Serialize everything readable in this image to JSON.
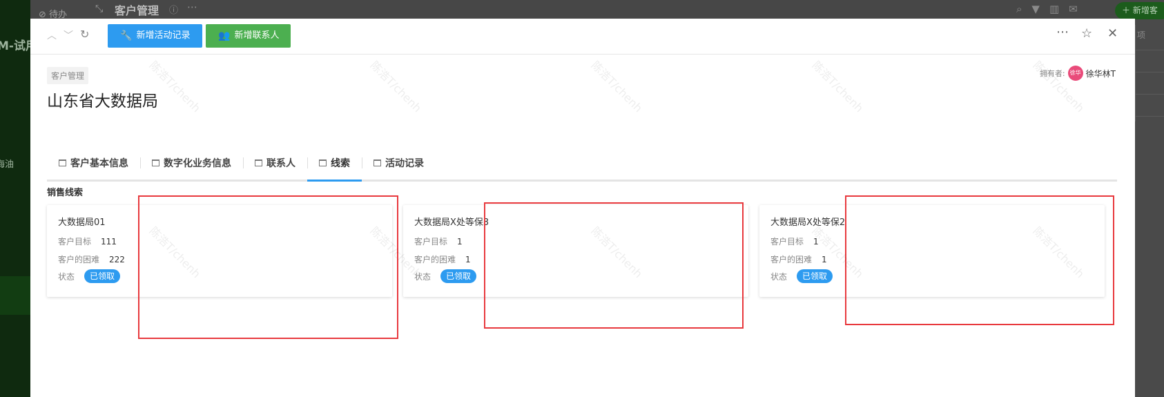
{
  "background": {
    "todo_label": "待办",
    "sidebar_text_1": "M-试用",
    "sidebar_text_2": "海油",
    "page_title": "客户管理",
    "add_button": "＋ 新增客",
    "right_panel_text": "项"
  },
  "toolbar": {
    "up_icon": "chevron-up-icon",
    "down_icon": "chevron-down-icon",
    "refresh_icon": "refresh-icon",
    "add_activity_label": "新增活动记录",
    "add_contact_label": "新增联系人",
    "more_icon": "more-icon",
    "star_icon": "star-icon",
    "close_icon": "close-icon"
  },
  "breadcrumb": "客户管理",
  "owner": {
    "label": "拥有者:",
    "avatar_text": "徐华",
    "name": "徐华林T"
  },
  "title": "山东省大数据局",
  "tabs": [
    {
      "label": "客户基本信息",
      "active": false
    },
    {
      "label": "数字化业务信息",
      "active": false
    },
    {
      "label": "联系人",
      "active": false
    },
    {
      "label": "线索",
      "active": true
    },
    {
      "label": "活动记录",
      "active": false
    }
  ],
  "section_title": "销售线索",
  "cards": [
    {
      "title": "大数据局01",
      "target_label": "客户目标",
      "target_value": "111",
      "difficulty_label": "客户的困难",
      "difficulty_value": "222",
      "status_label": "状态",
      "status_value": "已领取"
    },
    {
      "title": "大数据局X处等保3",
      "target_label": "客户目标",
      "target_value": "1",
      "difficulty_label": "客户的困难",
      "difficulty_value": "1",
      "status_label": "状态",
      "status_value": "已领取"
    },
    {
      "title": "大数据局X处等保2",
      "target_label": "客户目标",
      "target_value": "1",
      "difficulty_label": "客户的困难",
      "difficulty_value": "1",
      "status_label": "状态",
      "status_value": "已领取"
    }
  ],
  "watermark_text": "陈浩T/chenh",
  "colors": {
    "primary": "#2d9bf0",
    "success": "#4caf50",
    "annotation": "#e8383d",
    "avatar": "#e94b7a"
  }
}
